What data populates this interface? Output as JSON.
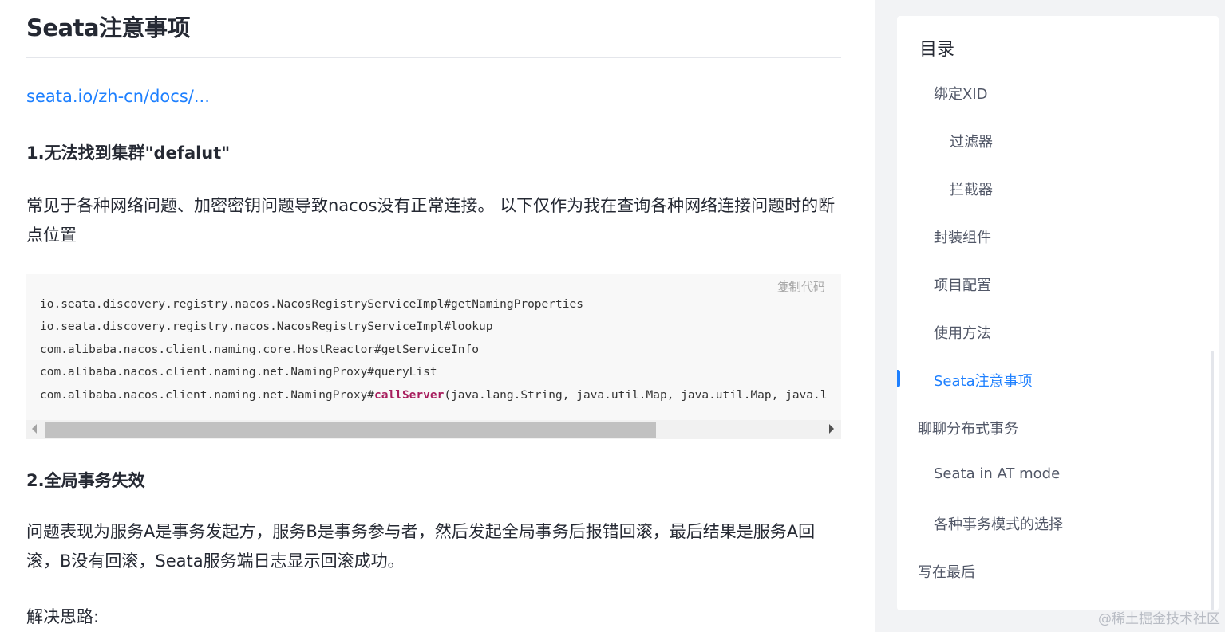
{
  "article": {
    "heading": "Seata注意事项",
    "link_text": "seata.io/zh-cn/docs/...",
    "section1_title": "1.无法找到集群\"defalut\"",
    "section1_text": "常见于各种网络问题、加密密钥问题导致nacos没有正常连接。 以下仅作为我在查询各种网络连接问题时的断点位置",
    "code": {
      "lang": "js",
      "copy_label": "复制代码",
      "lines": [
        "io.seata.discovery.registry.nacos.NacosRegistryServiceImpl#getNamingProperties",
        "io.seata.discovery.registry.nacos.NacosRegistryServiceImpl#lookup",
        "com.alibaba.nacos.client.naming.core.HostReactor#getServiceInfo",
        "com.alibaba.nacos.client.naming.net.NamingProxy#queryList"
      ],
      "last_line_prefix": "com.alibaba.nacos.client.naming.net.NamingProxy#",
      "last_line_highlight": "callServer",
      "last_line_suffix": "(java.lang.String, java.util.Map, java.util.Map, java.l"
    },
    "section2_title": "2.全局事务失效",
    "section2_text": "问题表现为服务A是事务发起方，服务B是事务参与者，然后发起全局事务后报错回滚，最后结果是服务A回滚，B没有回滚，Seata服务端日志显示回滚成功。",
    "section2_text2": "解决思路:"
  },
  "toc": {
    "title": "目录",
    "items": [
      {
        "label": "绑定XID",
        "active": false
      },
      {
        "label": "过滤器",
        "active": false
      },
      {
        "label": "拦截器",
        "active": false
      },
      {
        "label": "封装组件",
        "active": false
      },
      {
        "label": "项目配置",
        "active": false
      },
      {
        "label": "使用方法",
        "active": false
      },
      {
        "label": "Seata注意事项",
        "active": true
      },
      {
        "label": "聊聊分布式事务",
        "active": false
      },
      {
        "label": "Seata in AT mode",
        "active": false
      },
      {
        "label": "各种事务模式的选择",
        "active": false
      },
      {
        "label": "写在最后",
        "active": false
      }
    ]
  },
  "watermark": "@稀土掘金技术社区",
  "colors": {
    "accent": "#1e80ff",
    "text": "#252933",
    "code_bg": "#f8f8f8",
    "code_keyword": "#a71d5d",
    "sidebar_bg": "#f2f3f5"
  }
}
